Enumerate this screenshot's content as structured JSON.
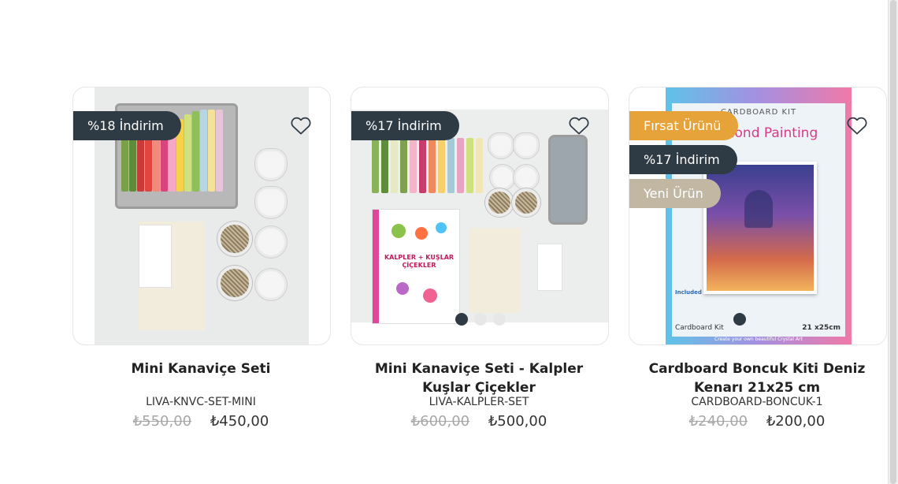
{
  "products": [
    {
      "name": "Mini Kanaviçe Seti",
      "sku": "LIVA-KNVC-SET-MINI",
      "old_price": "₺550,00",
      "price": "₺450,00",
      "badges": [
        "%18 İndirim"
      ]
    },
    {
      "name": "Mini Kanaviçe Seti - Kalpler Kuşlar Çiçekler",
      "sku": "LIVA-KALPLER-SET",
      "old_price": "₺600,00",
      "price": "₺500,00",
      "badges": [
        "%17 İndirim"
      ],
      "book_title": "KALPLER + KUŞLAR ÇİÇEKLER",
      "slider_dots": 3
    },
    {
      "name": "Cardboard Boncuk Kiti Deniz Kenarı 21x25 cm",
      "sku": "CARDBOARD-BONCUK-1",
      "old_price": "₺240,00",
      "price": "₺200,00",
      "badges": [
        "Fırsat Ürünü",
        "%17 İndirim",
        "Yeni Ürün"
      ],
      "box_texts": {
        "header": "CARDBOARD KIT",
        "title": "Diamond Painting",
        "footer": "Cardboard Kit",
        "size": "21 x25cm",
        "tagline": "Create your own beautiful Crystal Art",
        "included": "Included"
      },
      "slider_dots": 1
    }
  ],
  "icons": {
    "wishlist": "heart-outline-icon"
  },
  "colors": {
    "badge_dark": "#2e3a44",
    "badge_orange": "#e6a33a",
    "badge_beige": "#c2b7a3",
    "old_price": "#a7a7a7"
  }
}
